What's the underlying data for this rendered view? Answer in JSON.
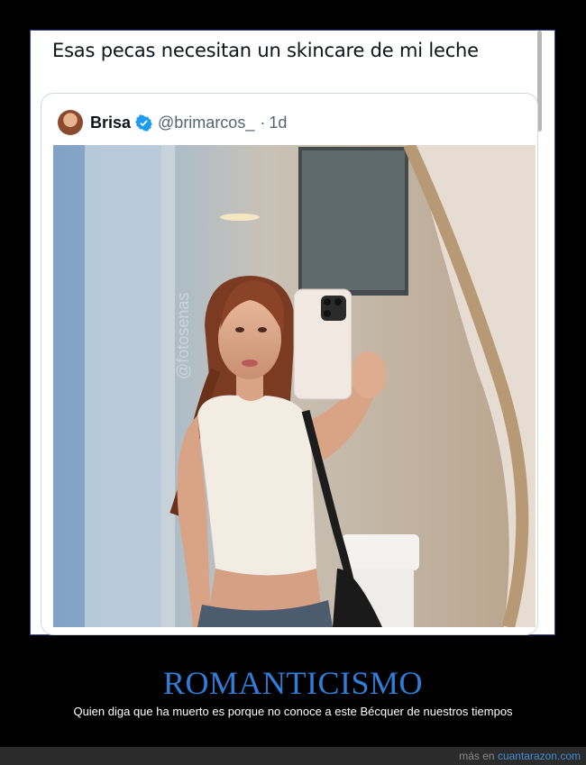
{
  "post": {
    "text": "Esas pecas necesitan un skincare de mi leche"
  },
  "quoted": {
    "author_name": "Brisa",
    "handle": "@brimarcos_",
    "separator": "·",
    "age": "1d",
    "media_watermark": "@fotosenas"
  },
  "caption": {
    "title": "ROMANTICISMO",
    "subtitle": "Quien diga que ha muerto es porque no conoce a este Bécquer de nuestros tiempos"
  },
  "footer": {
    "prefix": "más en ",
    "site": "cuantarazon.com"
  },
  "colors": {
    "title": "#2f7ed8",
    "verified": "#1d9bf0",
    "link": "#3f8fd6"
  }
}
